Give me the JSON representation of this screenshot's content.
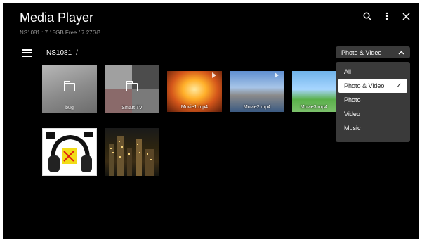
{
  "header": {
    "title": "Media Player",
    "storage": "NS1081 : 7.15GB Free / 7.27GB"
  },
  "breadcrumb": {
    "current": "NS1081",
    "separator": "/"
  },
  "filter": {
    "selected": "Photo & Video",
    "options": [
      "All",
      "Photo & Video",
      "Photo",
      "Video",
      "Music"
    ]
  },
  "tiles": [
    {
      "label": "bug",
      "type": "folder"
    },
    {
      "label": "Smart TV",
      "type": "folder"
    },
    {
      "label": "Movie1.mp4",
      "type": "video"
    },
    {
      "label": "Movie2.mp4",
      "type": "video"
    },
    {
      "label": "Movie3.mp4",
      "type": "video"
    },
    {
      "label": "",
      "type": "photo"
    },
    {
      "label": "",
      "type": "photo"
    }
  ],
  "icons": {
    "search": "search-icon",
    "more": "more-vertical-icon",
    "close": "close-icon",
    "menu": "hamburger-icon"
  },
  "colors": {
    "background": "#000000",
    "panel": "#3a3a3a",
    "text": "#ffffff"
  }
}
